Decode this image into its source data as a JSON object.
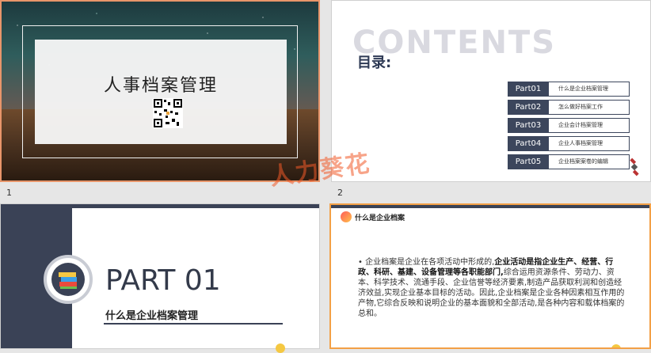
{
  "slide_numbers": [
    "1",
    "2"
  ],
  "slide1": {
    "title": "人事档案管理"
  },
  "slide2": {
    "bigword": "CONTENTS",
    "heading": "目录:",
    "items": [
      {
        "tag": "Part01",
        "text": "什么是企业档案管理"
      },
      {
        "tag": "Part02",
        "text": "怎么做好档案工作"
      },
      {
        "tag": "Part03",
        "text": "企业会计档案管理"
      },
      {
        "tag": "Part04",
        "text": "企业人事档案管理"
      },
      {
        "tag": "Part05",
        "text": "企业档案案卷的编辑"
      }
    ]
  },
  "slide3": {
    "part": "PART 01",
    "subtitle": "什么是企业档案管理"
  },
  "slide4": {
    "header": "什么是企业档案",
    "body_1": "企业档案是企业在各项活动中形成的,",
    "body_bold": "企业活动是指企业生产、经营、行政、科研、基建、设备管理等各职能部门,",
    "body_2": "综合运用资源条件、劳动力、资本、科学技术、流通手段、企业信誉等经济要素,制造产品获取利润和创造经济效益,实现企业基本目标的活动。因此,企业档案是企业各种因素相互作用的产物,它综合反映和说明企业的基本面貌和全部活动,是各种内容和载体档案的总和。"
  },
  "watermark": "人力葵花"
}
